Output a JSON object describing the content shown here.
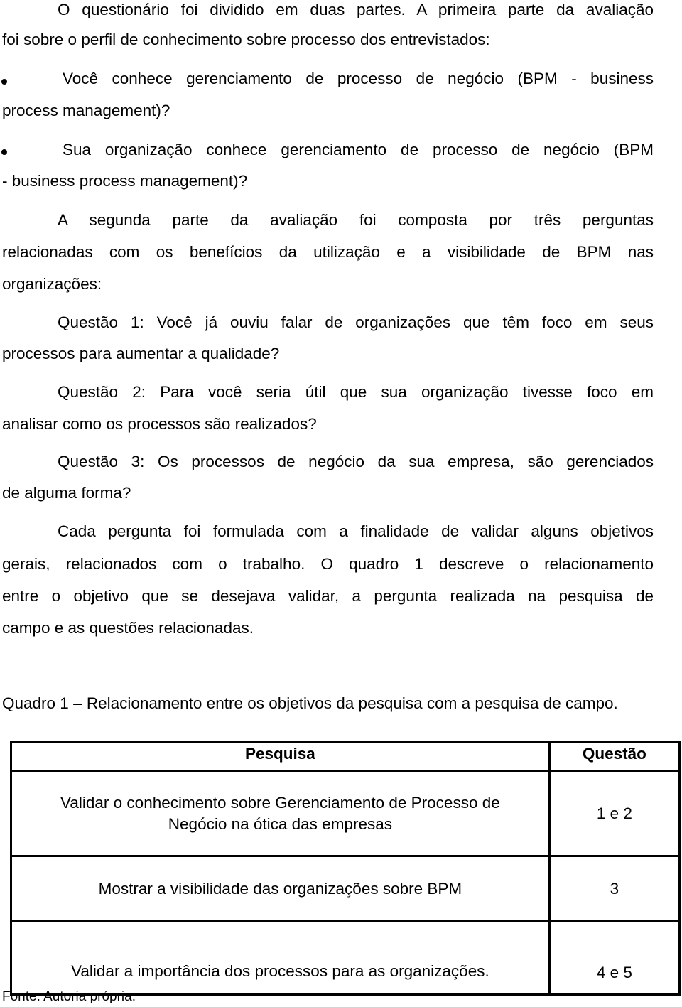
{
  "document": {
    "paragraph1": {
      "line1": "O questionário foi dividido em duas partes. A primeira parte da avaliação",
      "line2": "foi sobre o perfil de conhecimento sobre processo dos entrevistados:"
    },
    "bullets": [
      {
        "line1": "Você conhece gerenciamento de processo de negócio (BPM - business",
        "line2": "process management)?"
      },
      {
        "line1": "Sua organização conhece gerenciamento de processo de negócio (BPM",
        "line2": "- business process management)?"
      }
    ],
    "paragraph2": {
      "line1": "A segunda parte da avaliação foi composta por três perguntas",
      "line2": "relacionadas com os benefícios da utilização e a visibilidade de BPM nas",
      "line3": "organizações:"
    },
    "questions": [
      {
        "line1": "Questão 1: Você já ouviu falar de organizações que têm foco em seus",
        "line2": "processos para aumentar a qualidade?"
      },
      {
        "line1": "Questão 2: Para você seria útil que sua organização tivesse foco em",
        "line2": "analisar como os processos são realizados?"
      },
      {
        "line1": "Questão 3: Os processos de negócio da sua empresa, são gerenciados",
        "line2": "de alguma forma?"
      }
    ],
    "paragraph3": {
      "line1": "Cada pergunta foi formulada com a finalidade de validar alguns objetivos",
      "line2": "gerais, relacionados com o trabalho. O quadro 1 descreve o relacionamento",
      "line3": "entre o objetivo que se desejava validar, a pergunta realizada na pesquisa de",
      "line4": "campo e as questões relacionadas."
    },
    "table_caption": "Quadro 1 – Relacionamento entre os objetivos da pesquisa com a pesquisa de campo.",
    "table": {
      "headers": [
        "Pesquisa",
        "Questão"
      ],
      "rows": [
        {
          "pesquisa_line1": "Validar o conhecimento sobre Gerenciamento de Processo de",
          "pesquisa_line2": "Negócio na ótica das empresas",
          "questao": "1 e 2"
        },
        {
          "pesquisa_line1": "Mostrar a visibilidade das organizações sobre BPM",
          "questao": "3"
        },
        {
          "pesquisa_line1": "Validar a importância dos processos para as organizações.",
          "questao": "4 e 5"
        }
      ]
    },
    "source": "Fonte: Autoria própria."
  }
}
